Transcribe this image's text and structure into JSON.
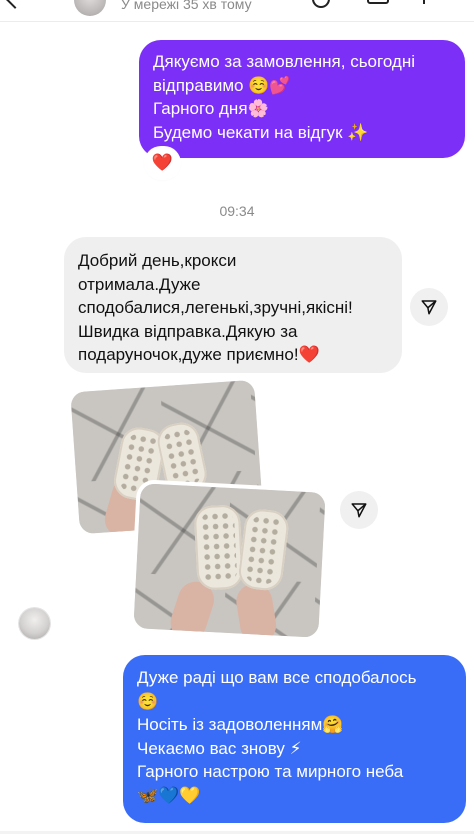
{
  "header": {
    "status": "У мережі 35 хв тому"
  },
  "messages": {
    "outgoing_1": {
      "lines": [
        "Дякуємо за замовлення, сьогодні",
        "відправимо ☺️💕",
        "Гарного дня🌸",
        "Будемо чекати на відгук ✨"
      ],
      "reaction": "❤️",
      "color": "#7b2ff7"
    },
    "timestamp": "09:34",
    "incoming_1": {
      "lines": [
        "Добрий день,крокси",
        "отримала.Дуже",
        "сподобалися,легенькі,зручні,якісні!",
        "Швидка відправка.Дякую за",
        "подаруночок,дуже приємно!❤️"
      ]
    },
    "outgoing_2": {
      "lines": [
        "Дуже раді що вам все сподобалось",
        "☺️",
        "Носіть із задоволенням🤗",
        "Чекаємо вас знову ⚡",
        "Гарного настрою та мирного неба",
        "🦋💙💛"
      ],
      "color": "#3a6df7"
    }
  },
  "icons": {
    "share": "paper-plane-icon",
    "back": "chevron-left-icon",
    "phone": "phone-icon",
    "video": "video-icon",
    "flag": "flag-icon"
  }
}
